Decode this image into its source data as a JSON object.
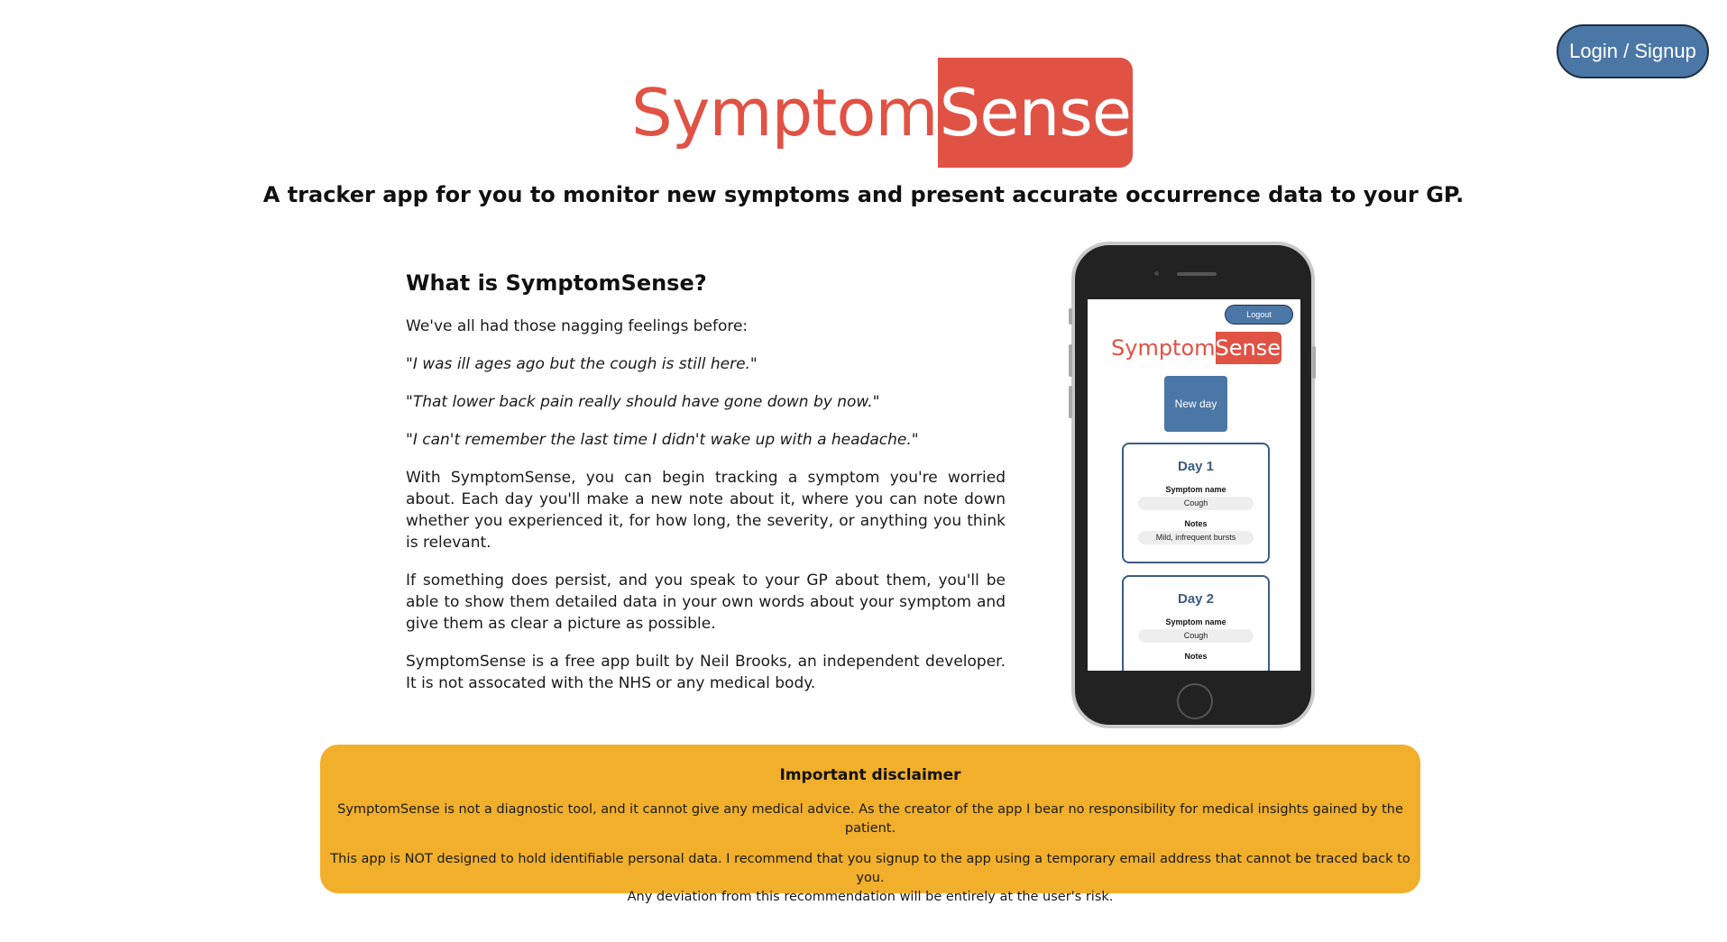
{
  "auth": {
    "login_label": "Login / Signup"
  },
  "logo": {
    "part1": "Symptom",
    "part2": "Sense"
  },
  "tagline": "A tracker app for you to monitor new symptoms and present accurate occurrence data to your GP.",
  "about": {
    "heading": "What is SymptomSense?",
    "intro": "We've all had those nagging feelings before:",
    "quotes": [
      "\"I was ill ages ago but the cough is still here.\"",
      "\"That lower back pain really should have gone down by now.\"",
      "\"I can't remember the last time I didn't wake up with a headache.\""
    ],
    "paragraphs": [
      "With SymptomSense, you can begin tracking a symptom you're worried about. Each day you'll make a new note about it, where you can note down whether you experienced it, for how long, the severity, or anything you think is relevant.",
      "If something does persist, and you speak to your GP about them, you'll be able to show them detailed data in your own words about your symptom and give them as clear a picture as possible.",
      "SymptomSense is a free app built by Neil Brooks, an independent developer. It is not assocated with the NHS or any medical body."
    ]
  },
  "phone_preview": {
    "logout_label": "Logout",
    "logo_part1": "Symptom",
    "logo_part2": "Sense",
    "new_day_label": "New day",
    "cards": [
      {
        "title": "Day 1",
        "symptom_label": "Symptom name",
        "symptom_value": "Cough",
        "notes_label": "Notes",
        "notes_value": "Mild, infrequent bursts"
      },
      {
        "title": "Day 2",
        "symptom_label": "Symptom name",
        "symptom_value": "Cough",
        "notes_label": "Notes",
        "notes_value": ""
      }
    ]
  },
  "disclaimer": {
    "title": "Important disclaimer",
    "line1": "SymptomSense is not a diagnostic tool, and it cannot give any medical advice. As the creator of the app I bear no responsibility for medical insights gained by the patient.",
    "line2": "This app is NOT designed to hold identifiable personal data. I recommend that you signup to the app using a temporary email address that cannot be traced back to you.",
    "line3": "Any deviation from this recommendation will be entirely at the user's risk."
  },
  "colors": {
    "brand_red": "#e05244",
    "button_blue": "#4a77a6",
    "disclaimer_bg": "#f1af2b"
  }
}
